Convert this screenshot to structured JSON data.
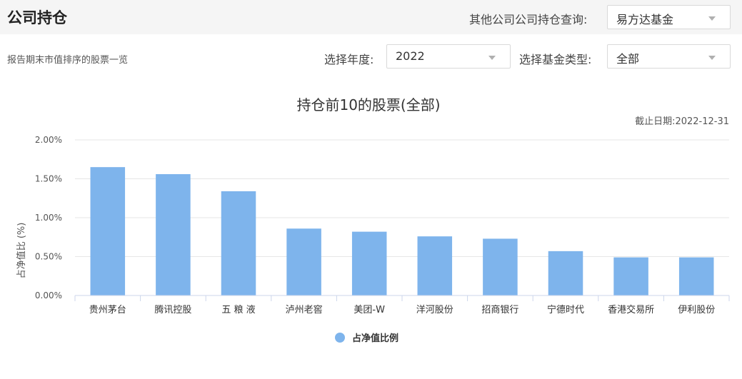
{
  "header": {
    "title": "公司持仓",
    "other_company_label": "其他公司公司持仓查询:",
    "company_select_value": "易方达基金"
  },
  "filters": {
    "caption": "报告期末市值排序的股票一览",
    "year_label": "选择年度:",
    "year_value": "2022",
    "fund_type_label": "选择基金类型:",
    "fund_type_value": "全部"
  },
  "chart_data": {
    "type": "bar",
    "title": "持仓前10的股票(全部)",
    "date_note": "截止日期:2022-12-31",
    "ylabel": "占净值比 (%)",
    "xlabel": "",
    "ylim": [
      0,
      2.0
    ],
    "yticks": [
      "0.00%",
      "0.50%",
      "1.00%",
      "1.50%",
      "2.00%"
    ],
    "categories": [
      "贵州茅台",
      "腾讯控股",
      "五 粮 液",
      "泸州老窖",
      "美团-W",
      "洋河股份",
      "招商银行",
      "宁德时代",
      "香港交易所",
      "伊利股份"
    ],
    "series": [
      {
        "name": "占净值比例",
        "values": [
          1.65,
          1.56,
          1.34,
          0.86,
          0.82,
          0.76,
          0.73,
          0.57,
          0.49,
          0.49
        ]
      }
    ],
    "bar_color": "#7eb4ec",
    "grid": true,
    "legend": "bottom-center"
  }
}
